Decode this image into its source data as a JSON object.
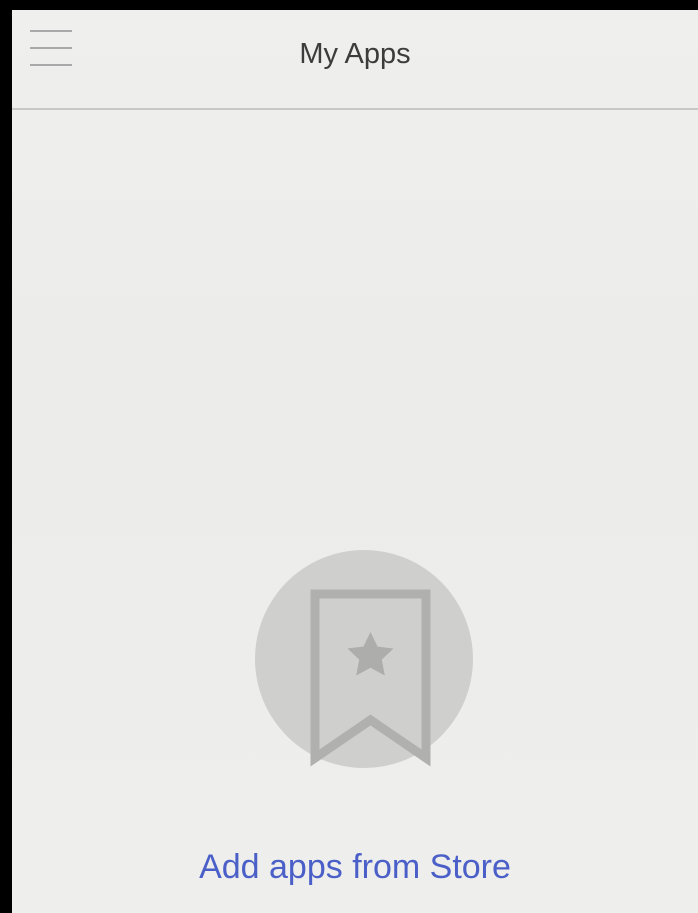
{
  "header": {
    "title": "My Apps",
    "menu_icon": "hamburger-menu-icon"
  },
  "empty_state": {
    "icon": "bookmark-star-icon",
    "link_label": "Add apps from Store",
    "link_color": "#4b5fc8"
  }
}
